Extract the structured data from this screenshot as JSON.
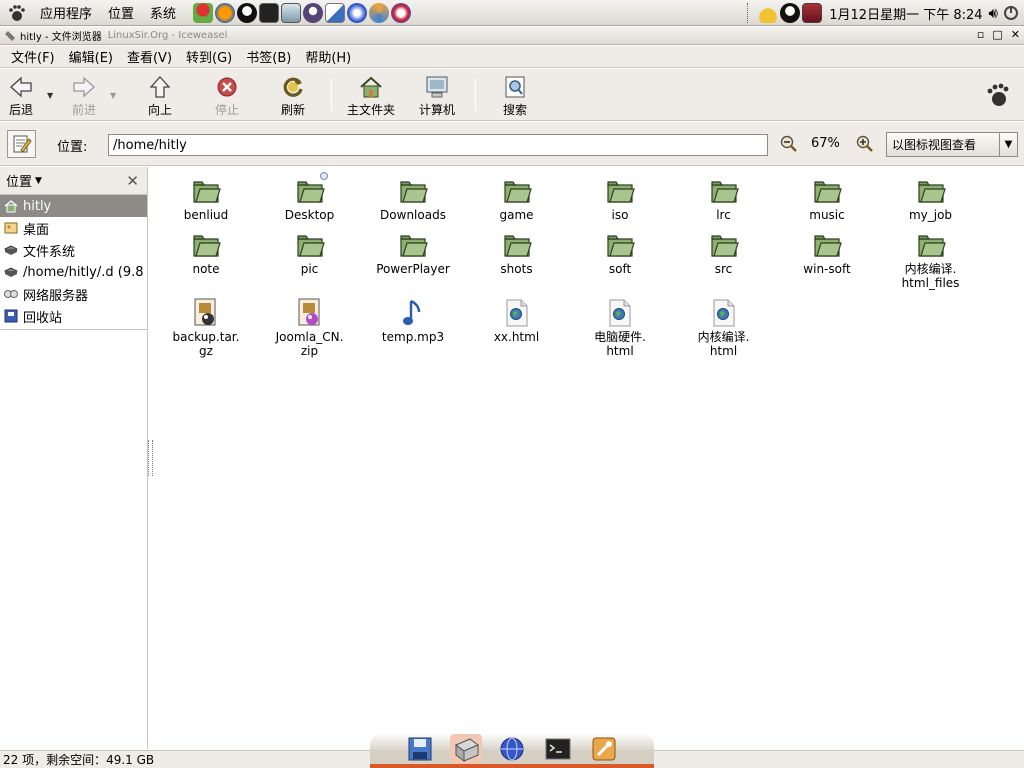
{
  "panel": {
    "menus": [
      "应用程序",
      "位置",
      "系统"
    ],
    "clock": "1月12日星期一 下午 8:24"
  },
  "window": {
    "title": "hitly - 文件浏览器",
    "behind_title": "LinuxSir.Org - Iceweasel"
  },
  "menubar": [
    "文件(F)",
    "编辑(E)",
    "查看(V)",
    "转到(G)",
    "书签(B)",
    "帮助(H)"
  ],
  "toolbar": {
    "back": "后退",
    "forward": "前进",
    "up": "向上",
    "stop": "停止",
    "reload": "刷新",
    "home": "主文件夹",
    "computer": "计算机",
    "search": "搜索"
  },
  "location": {
    "label": "位置:",
    "path": "/home/hitly",
    "zoom": "67%",
    "view_mode": "以图标视图查看"
  },
  "sidebar": {
    "title": "位置",
    "items": [
      {
        "label": "hitly",
        "selected": true
      },
      {
        "label": "桌面",
        "selected": false
      },
      {
        "label": "文件系统",
        "selected": false
      },
      {
        "label": "/home/hitly/.d (9.8",
        "selected": false
      },
      {
        "label": "网络服务器",
        "selected": false
      },
      {
        "label": "回收站",
        "selected": false
      }
    ]
  },
  "files": [
    {
      "name": "benliud",
      "type": "folder"
    },
    {
      "name": "Desktop",
      "type": "folder-badge"
    },
    {
      "name": "Downloads",
      "type": "folder"
    },
    {
      "name": "game",
      "type": "folder"
    },
    {
      "name": "iso",
      "type": "folder"
    },
    {
      "name": "lrc",
      "type": "folder"
    },
    {
      "name": "music",
      "type": "folder"
    },
    {
      "name": "my_job",
      "type": "folder"
    },
    {
      "name": "note",
      "type": "folder"
    },
    {
      "name": "pic",
      "type": "folder"
    },
    {
      "name": "PowerPlayer",
      "type": "folder"
    },
    {
      "name": "shots",
      "type": "folder"
    },
    {
      "name": "soft",
      "type": "folder"
    },
    {
      "name": "src",
      "type": "folder"
    },
    {
      "name": "win-soft",
      "type": "folder"
    },
    {
      "name": "内核编译.\nhtml_files",
      "type": "folder"
    },
    {
      "name": "backup.tar.\ngz",
      "type": "archive"
    },
    {
      "name": "Joomla_CN.\nzip",
      "type": "archive-zip"
    },
    {
      "name": "temp.mp3",
      "type": "audio"
    },
    {
      "name": "xx.html",
      "type": "html"
    },
    {
      "name": "电脑硬件.\nhtml",
      "type": "html"
    },
    {
      "name": "内核编译.\nhtml",
      "type": "html"
    }
  ],
  "status": "22 项，剩余空间：49.1 GB",
  "colors": {
    "folder_green": "#8cb070",
    "selection": "#8d8b87",
    "chrome": "#efebe7",
    "dock_accent": "#d85a2a"
  }
}
